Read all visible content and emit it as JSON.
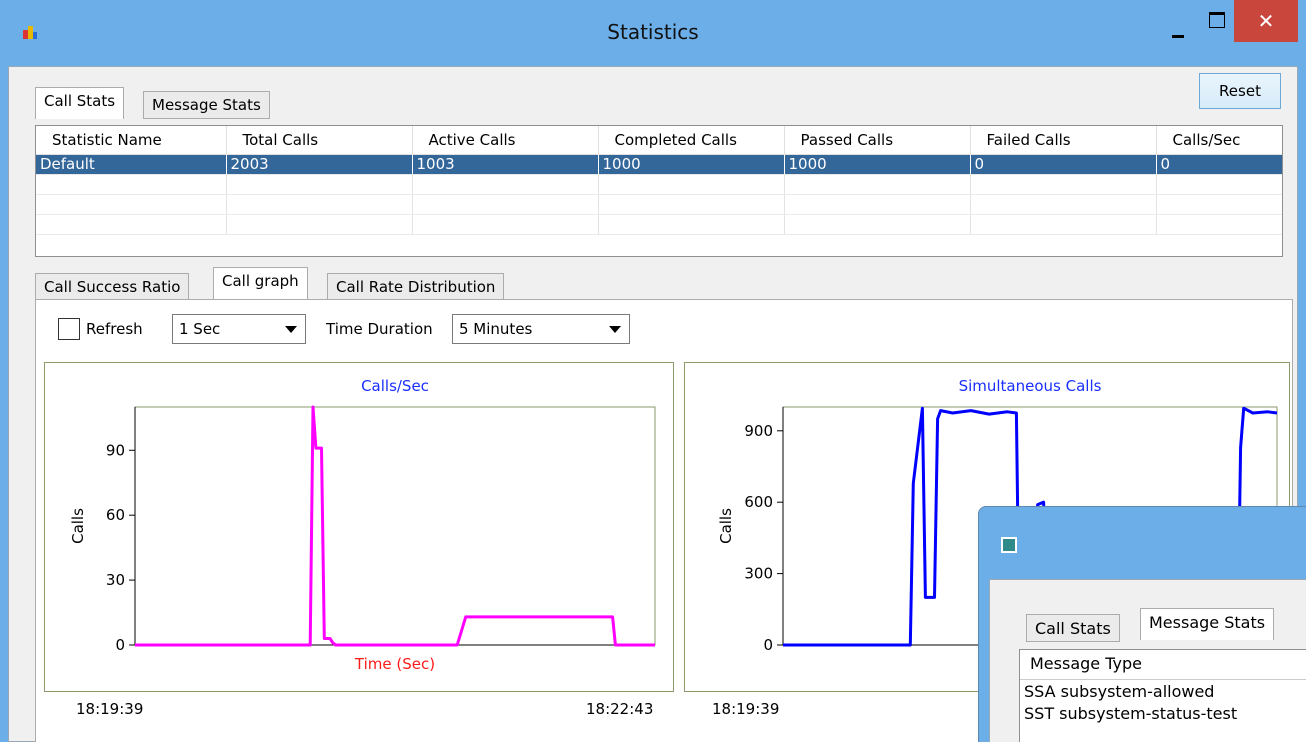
{
  "window": {
    "title": "Statistics"
  },
  "window_controls": {
    "close": "✕"
  },
  "top_tabs": [
    {
      "label": "Call Stats",
      "active": true
    },
    {
      "label": "Message Stats",
      "active": false
    }
  ],
  "reset_label": "Reset",
  "stats_table": {
    "columns": [
      "Statistic Name",
      "Total Calls",
      "Active Calls",
      "Completed Calls",
      "Passed Calls",
      "Failed Calls",
      "Calls/Sec"
    ],
    "rows": [
      [
        "Default",
        "2003",
        "1003",
        "1000",
        "1000",
        "0",
        "0"
      ]
    ]
  },
  "graph_tabs": [
    {
      "label": "Call Success Ratio",
      "active": false
    },
    {
      "label": "Call graph",
      "active": true
    },
    {
      "label": "Call Rate Distribution",
      "active": false
    }
  ],
  "controls": {
    "refresh_label": "Refresh",
    "refresh_checked": false,
    "refresh_value": "1 Sec",
    "duration_label": "Time Duration",
    "duration_value": "5 Minutes"
  },
  "chart_data": [
    {
      "type": "line",
      "title": "Calls/Sec",
      "xlabel": "Time (Sec)",
      "ylabel": "Calls",
      "yticks": [
        "0",
        "30",
        "60",
        "90"
      ],
      "ylim": [
        0,
        110
      ],
      "xlim": [
        0,
        184
      ],
      "x_start_label": "18:19:39",
      "x_end_label": "18:22:43",
      "color": "#ff00ff",
      "grid": false,
      "x": [
        0,
        62,
        63,
        64,
        66,
        67,
        69,
        70,
        71,
        114,
        117,
        169,
        170,
        184
      ],
      "y": [
        0,
        0,
        110,
        91,
        91,
        3,
        3,
        1,
        0,
        0,
        13,
        13,
        0,
        0
      ]
    },
    {
      "type": "line",
      "title": "Simultaneous Calls",
      "xlabel": "",
      "ylabel": "Calls",
      "yticks": [
        "0",
        "300",
        "600",
        "900"
      ],
      "ylim": [
        0,
        1000
      ],
      "x_start_label": "18:19:39",
      "color": "#0000ff",
      "grid": false,
      "x": [
        0,
        42,
        43,
        46,
        47,
        50,
        51,
        52,
        56,
        62,
        68,
        74,
        77,
        78,
        82,
        84,
        86,
        88,
        90,
        94,
        150,
        151,
        152,
        155,
        160,
        163
      ],
      "y": [
        0,
        0,
        680,
        995,
        200,
        200,
        950,
        985,
        975,
        985,
        970,
        980,
        975,
        0,
        0,
        590,
        600,
        0,
        0,
        0,
        0,
        830,
        995,
        975,
        980,
        975
      ]
    }
  ],
  "popup": {
    "tabs": [
      "Call Stats",
      "Message Stats"
    ],
    "list_header": "Message Type",
    "items": [
      "SSA subsystem-allowed",
      "SST subsystem-status-test"
    ]
  }
}
